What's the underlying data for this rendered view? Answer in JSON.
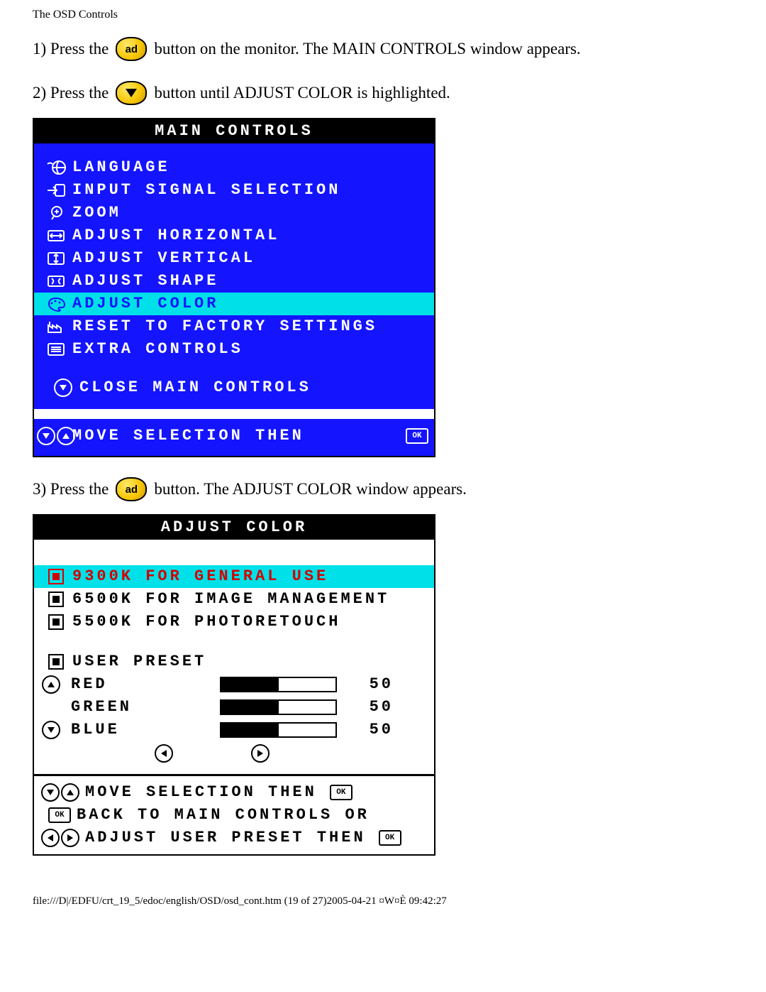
{
  "header": "The OSD Controls",
  "steps": {
    "s1a": "1) Press the",
    "s1b": "button on the monitor. The MAIN CONTROLS window appears.",
    "s2a": "2) Press the",
    "s2b": "button until ADJUST COLOR is highlighted.",
    "s3a": "3) Press the",
    "s3b": "button. The ADJUST COLOR window appears."
  },
  "icon_labels": {
    "ok": "ad",
    "ok_small": "OK"
  },
  "main_controls": {
    "title": "MAIN CONTROLS",
    "items": [
      {
        "id": "language",
        "label": "LANGUAGE"
      },
      {
        "id": "input-signal",
        "label": "INPUT SIGNAL SELECTION"
      },
      {
        "id": "zoom",
        "label": "ZOOM"
      },
      {
        "id": "adj-horizontal",
        "label": "ADJUST HORIZONTAL"
      },
      {
        "id": "adj-vertical",
        "label": "ADJUST VERTICAL"
      },
      {
        "id": "adj-shape",
        "label": "ADJUST SHAPE"
      },
      {
        "id": "adj-color",
        "label": "ADJUST COLOR",
        "highlight": true
      },
      {
        "id": "reset-factory",
        "label": "RESET TO FACTORY SETTINGS"
      },
      {
        "id": "extra-controls",
        "label": "EXTRA CONTROLS"
      }
    ],
    "close": "CLOSE MAIN CONTROLS",
    "hint": "MOVE SELECTION THEN"
  },
  "adjust_color": {
    "title": "ADJUST COLOR",
    "options": [
      {
        "id": "9300k",
        "label": "9300K FOR GENERAL USE",
        "selected": true
      },
      {
        "id": "6500k",
        "label": "6500K FOR IMAGE MANAGEMENT"
      },
      {
        "id": "5500k",
        "label": "5500K FOR PHOTORETOUCH"
      }
    ],
    "user_preset": "USER PRESET",
    "channels": [
      {
        "id": "red",
        "label": "RED",
        "value": 50
      },
      {
        "id": "green",
        "label": "GREEN",
        "value": 50
      },
      {
        "id": "blue",
        "label": "BLUE",
        "value": 50
      }
    ],
    "hint1": "MOVE SELECTION THEN",
    "hint2": "BACK TO MAIN CONTROLS OR",
    "hint3": "ADJUST USER PRESET THEN"
  },
  "footer": "file:///D|/EDFU/crt_19_5/edoc/english/OSD/osd_cont.htm (19 of 27)2005-04-21 ¤W¤È 09:42:27"
}
